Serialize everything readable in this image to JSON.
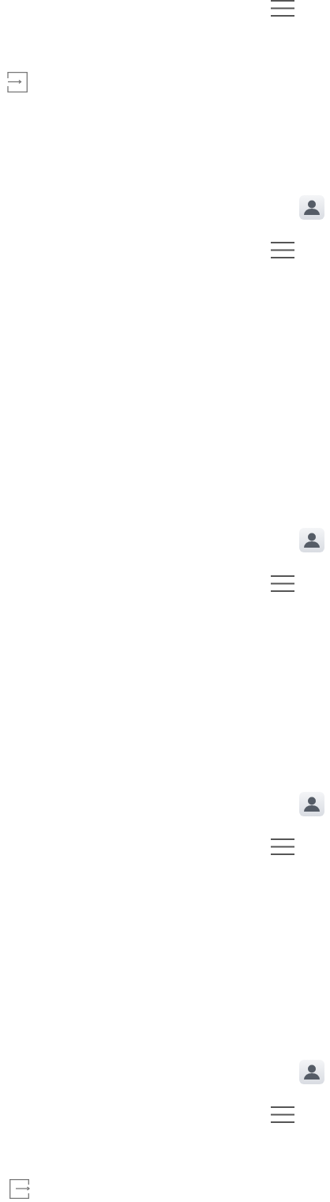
{
  "rows": [
    {
      "kind": "menu"
    },
    {
      "kind": "login"
    },
    {
      "kind": "avatar"
    },
    {
      "kind": "menu"
    },
    {
      "kind": "avatar"
    },
    {
      "kind": "menu"
    },
    {
      "kind": "avatar"
    },
    {
      "kind": "menu"
    },
    {
      "kind": "avatar"
    },
    {
      "kind": "menu"
    },
    {
      "kind": "logout"
    }
  ]
}
